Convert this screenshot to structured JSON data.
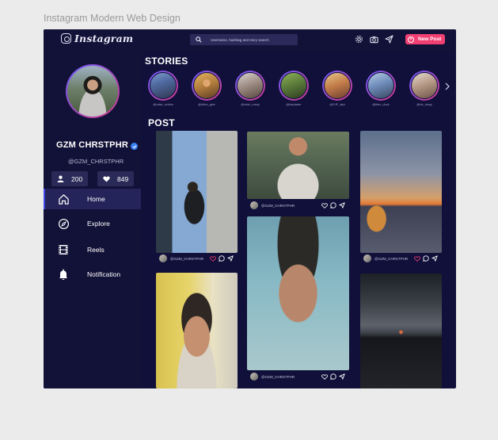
{
  "canvas": {
    "title": "Instagram Modern Web Design"
  },
  "app": {
    "logo": "Instagram"
  },
  "search": {
    "placeholder": "Username, hashtag and story search"
  },
  "header": {
    "new_post_label": "New Post"
  },
  "profile": {
    "username": "GZM CHRSTPHR",
    "handle": "@GZM_CHRSTPHR",
    "following_count": "200",
    "likes_count": "849"
  },
  "nav": [
    {
      "label": "Home",
      "icon": "home-icon",
      "active": true
    },
    {
      "label": "Explore",
      "icon": "compass-icon",
      "active": false
    },
    {
      "label": "Reels",
      "icon": "film-icon",
      "active": false
    },
    {
      "label": "Notification",
      "icon": "bell-icon",
      "active": false
    }
  ],
  "stories": {
    "title": "STORIES",
    "items": [
      {
        "name": "@ralar_violins"
      },
      {
        "name": "@ditzo_gntr"
      },
      {
        "name": "@ahel_rossy"
      },
      {
        "name": "@ksplader"
      },
      {
        "name": "@GIF_sipt"
      },
      {
        "name": "@ifarr_dock"
      },
      {
        "name": "@ris_lossy"
      }
    ]
  },
  "posts": {
    "title": "POST",
    "items": [
      {
        "user": "@GZM_CHRSTPHR",
        "liked": true
      },
      {
        "user": "@GZM_CHRSTPHR",
        "liked": false
      },
      {
        "user": "@GZM_CHRSTPHR",
        "liked": true
      },
      {
        "user": "@GZM_CHRSTPHR",
        "liked": false
      }
    ]
  },
  "colors": {
    "background": "#11103a",
    "accent": "#f04072",
    "active_nav": "#3f46e8",
    "story_ring_start": "#6a5cff",
    "story_ring_end": "#d23a8a"
  }
}
